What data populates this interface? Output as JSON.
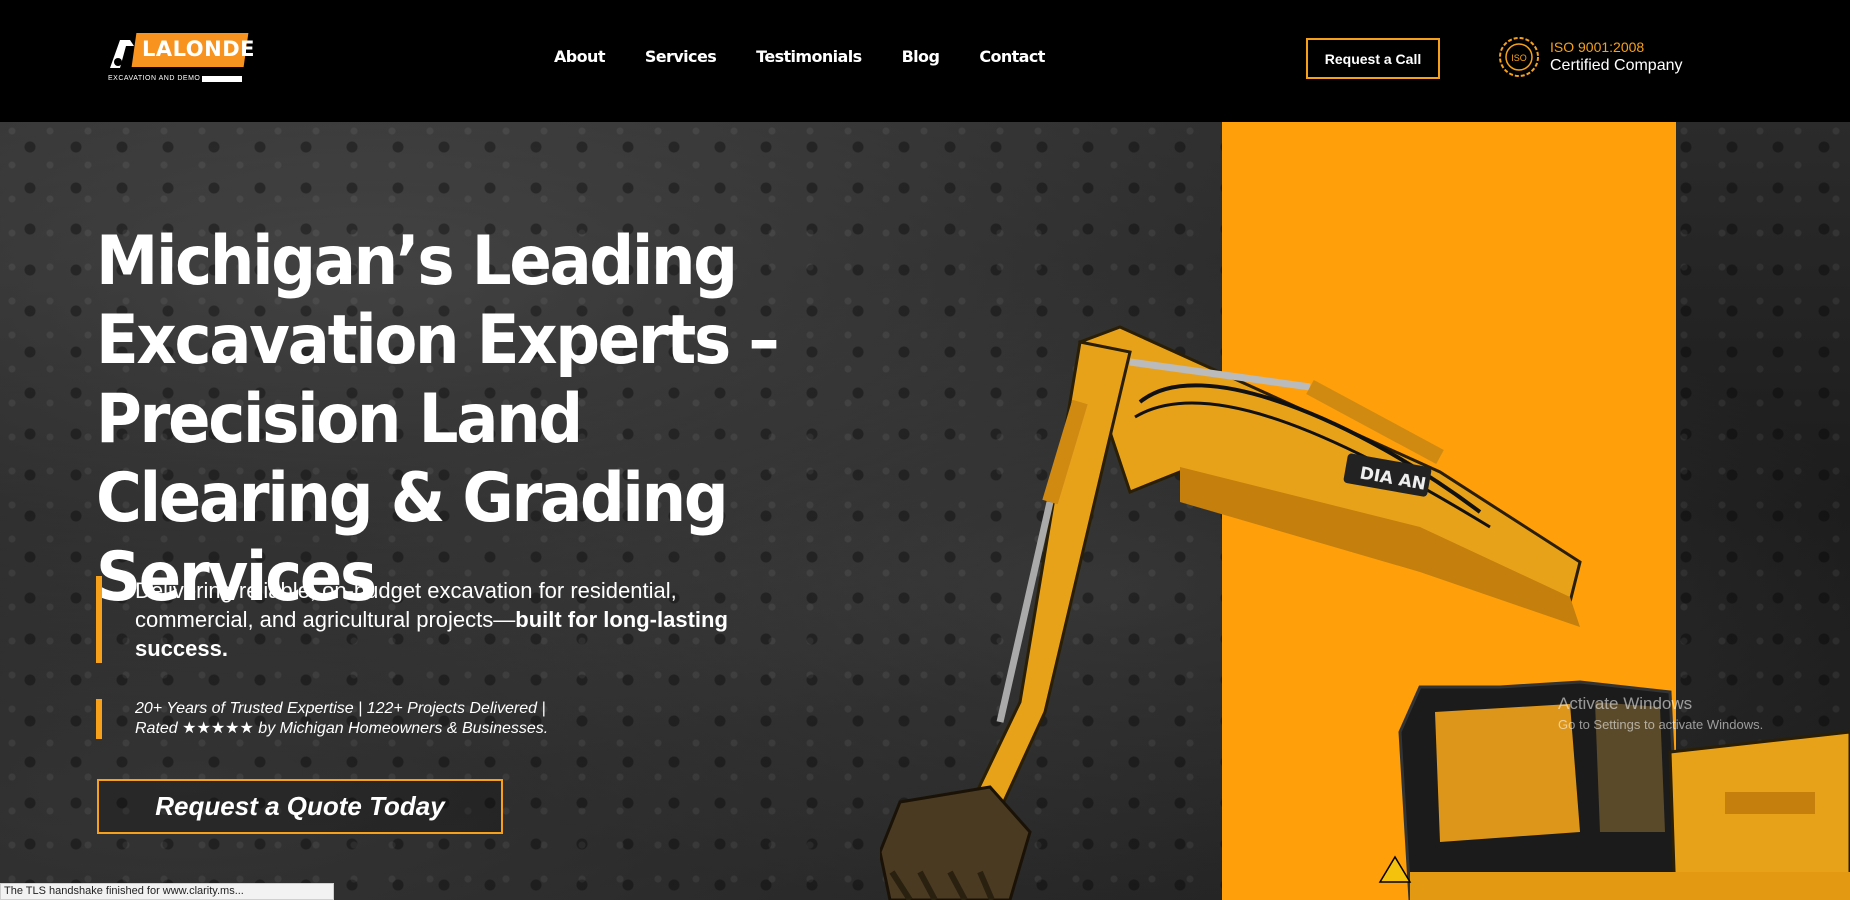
{
  "logo": {
    "name": "LALONDE",
    "tagline": "EXCAVATION AND DEMO"
  },
  "nav": {
    "items": [
      "About",
      "Services",
      "Testimonials",
      "Blog",
      "Contact"
    ]
  },
  "header": {
    "call_button": "Request a Call",
    "iso_line1": "ISO 9001:2008",
    "iso_line2": "Certified Company",
    "iso_badge": "ISO"
  },
  "hero": {
    "headline": "Michigan’s Leading Excavation Experts – Precision Land Clearing & Grading Services",
    "lead_plain": "Delivering reliable, on-budget excavation for residential, commercial, and agricultural projects—",
    "lead_bold": "built for long-lasting success.",
    "stats_line1": "20+ Years of Trusted Expertise | 122+ Projects Delivered |",
    "stats_line2": "Rated ★★★★★ by Michigan Homeowners & Businesses.",
    "cta_button": "Request a Quote Today",
    "excavator_label": "DIA AN"
  },
  "system": {
    "watermark_title": "Activate Windows",
    "watermark_sub": "Go to Settings to activate Windows.",
    "status_text": "The TLS handshake finished for www.clarity.ms..."
  },
  "colors": {
    "accent": "#f7a11a",
    "panel": "#ff9f0a",
    "background": "#000000"
  }
}
